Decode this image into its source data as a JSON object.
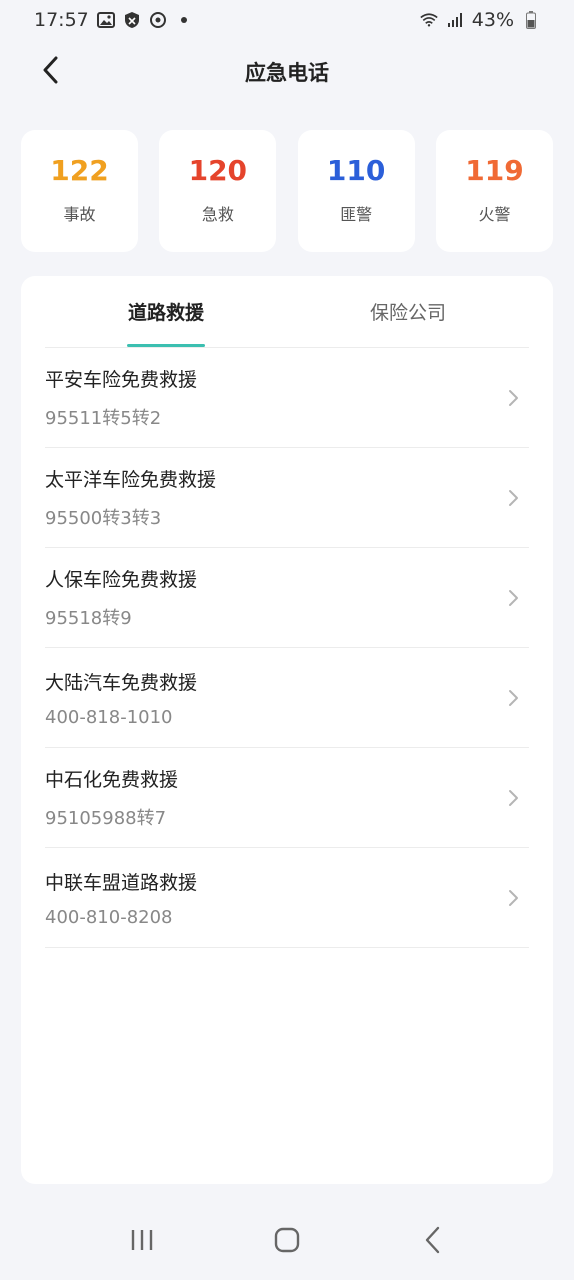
{
  "status_bar": {
    "time": "17:57",
    "battery": "43%",
    "icons": [
      "image-icon",
      "shield-icon",
      "sync-icon",
      "wifi-icon",
      "signal-icon",
      "battery-icon"
    ]
  },
  "header": {
    "title": "应急电话",
    "back_icon": "chevron-left-icon"
  },
  "emergency_numbers": [
    {
      "number": "122",
      "label": "事故",
      "color": "#f0a020"
    },
    {
      "number": "120",
      "label": "急救",
      "color": "#e5442c"
    },
    {
      "number": "110",
      "label": "匪警",
      "color": "#2b5fd9"
    },
    {
      "number": "119",
      "label": "火警",
      "color": "#f06a35"
    }
  ],
  "tabs": [
    {
      "label": "道路救援",
      "active": true
    },
    {
      "label": "保险公司",
      "active": false
    }
  ],
  "rescue_list": [
    {
      "title": "平安车险免费救援",
      "phone": "95511转5转2"
    },
    {
      "title": "太平洋车险免费救援",
      "phone": "95500转3转3"
    },
    {
      "title": "人保车险免费救援",
      "phone": "95518转9"
    },
    {
      "title": "大陆汽车免费救援",
      "phone": "400-818-1010"
    },
    {
      "title": "中石化免费救援",
      "phone": "95105988转7"
    },
    {
      "title": "中联车盟道路救援",
      "phone": "400-810-8208"
    }
  ],
  "accent_color": "#3bbfb0",
  "nav_bar": {
    "icons": [
      "recent-apps-icon",
      "home-icon",
      "back-icon"
    ]
  }
}
